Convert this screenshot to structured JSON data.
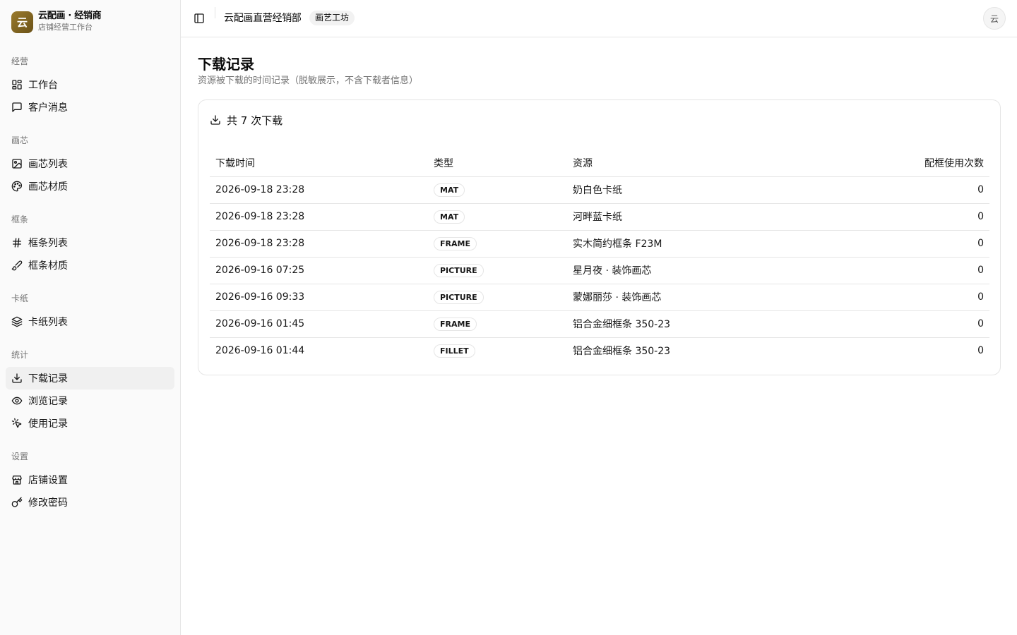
{
  "brand": {
    "logo_char": "云",
    "title": "云配画 · 经销商",
    "subtitle": "店铺经营工作台"
  },
  "sidebar": {
    "groups": [
      {
        "label": "经营",
        "items": [
          {
            "label": "工作台",
            "icon": "layout-grid-icon"
          },
          {
            "label": "客户消息",
            "icon": "message-square-icon"
          }
        ]
      },
      {
        "label": "画芯",
        "items": [
          {
            "label": "画芯列表",
            "icon": "image-icon"
          },
          {
            "label": "画芯材质",
            "icon": "palette-icon"
          }
        ]
      },
      {
        "label": "框条",
        "items": [
          {
            "label": "框条列表",
            "icon": "hash-icon"
          },
          {
            "label": "框条材质",
            "icon": "brush-icon"
          }
        ]
      },
      {
        "label": "卡纸",
        "items": [
          {
            "label": "卡纸列表",
            "icon": "layers-icon"
          }
        ]
      },
      {
        "label": "统计",
        "items": [
          {
            "label": "下载记录",
            "icon": "download-icon",
            "active": true
          },
          {
            "label": "浏览记录",
            "icon": "eye-icon"
          },
          {
            "label": "使用记录",
            "icon": "pointer-click-icon"
          }
        ]
      },
      {
        "label": "设置",
        "items": [
          {
            "label": "店铺设置",
            "icon": "store-icon"
          },
          {
            "label": "修改密码",
            "icon": "key-icon"
          }
        ]
      }
    ]
  },
  "header": {
    "org_name": "云配画直营经销部",
    "org_badge": "画艺工坊",
    "avatar_char": "云"
  },
  "page": {
    "title": "下载记录",
    "subtitle": "资源被下载的时间记录（脱敏展示，不含下载者信息）"
  },
  "card": {
    "summary": "共 7 次下载"
  },
  "table": {
    "columns": [
      "下载时间",
      "类型",
      "资源",
      "配框使用次数"
    ],
    "rows": [
      {
        "time": "2026-09-18 23:28",
        "type": "MAT",
        "resource": "奶白色卡纸",
        "count": "0"
      },
      {
        "time": "2026-09-18 23:28",
        "type": "MAT",
        "resource": "河畔蓝卡纸",
        "count": "0"
      },
      {
        "time": "2026-09-18 23:28",
        "type": "FRAME",
        "resource": "实木简约框条 F23M",
        "count": "0"
      },
      {
        "time": "2026-09-16 07:25",
        "type": "PICTURE",
        "resource": "星月夜 · 装饰画芯",
        "count": "0"
      },
      {
        "time": "2026-09-16 09:33",
        "type": "PICTURE",
        "resource": "蒙娜丽莎 · 装饰画芯",
        "count": "0"
      },
      {
        "time": "2026-09-16 01:45",
        "type": "FRAME",
        "resource": "铝合金细框条 350-23",
        "count": "0"
      },
      {
        "time": "2026-09-16 01:44",
        "type": "FILLET",
        "resource": "铝合金细框条 350-23",
        "count": "0"
      }
    ]
  },
  "colors": {
    "brand_gold": "#9a7a2c",
    "sidebar_bg": "#fafafa",
    "active_item_bg": "#f0f0f0",
    "border": "#e5e5e5",
    "muted_text": "#737373"
  }
}
